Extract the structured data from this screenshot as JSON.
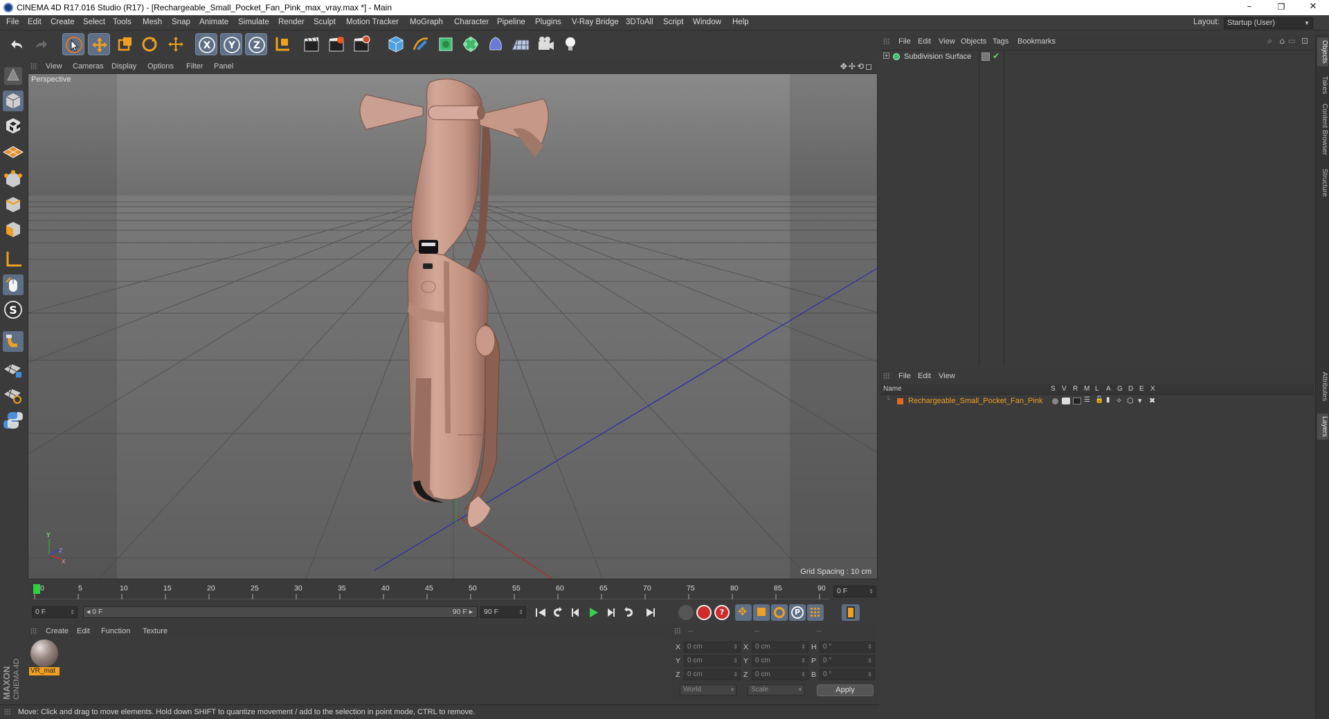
{
  "window": {
    "title": "CINEMA 4D R17.016 Studio (R17) - [Rechargeable_Small_Pocket_Fan_Pink_max_vray.max *] - Main",
    "minimize": "–",
    "restore": "❐",
    "close": "✕"
  },
  "menubar": {
    "items": [
      "File",
      "Edit",
      "Create",
      "Select",
      "Tools",
      "Mesh",
      "Snap",
      "Animate",
      "Simulate",
      "Render",
      "Sculpt",
      "Motion Tracker",
      "MoGraph",
      "Character",
      "Pipeline",
      "Plugins",
      "V-Ray Bridge",
      "3DToAll",
      "Script",
      "Window",
      "Help"
    ],
    "layout_label": "Layout:",
    "layout_value": "Startup (User)"
  },
  "viewport": {
    "menu": [
      "View",
      "Cameras",
      "Display",
      "Options",
      "Filter",
      "Panel"
    ],
    "label": "Perspective",
    "grid_spacing": "Grid Spacing : 10 cm",
    "nav_icons": "✥✢⟲◻"
  },
  "timeline": {
    "ticks": [
      "0",
      "5",
      "10",
      "15",
      "20",
      "25",
      "30",
      "35",
      "40",
      "45",
      "50",
      "55",
      "60",
      "65",
      "70",
      "75",
      "80",
      "85",
      "90"
    ],
    "current_frame": "0 F",
    "start_field": "0 F",
    "range_start": "◂ 0 F",
    "range_end": "90 F ▸",
    "end_field": "90 F"
  },
  "material_manager": {
    "menu": [
      "Create",
      "Edit",
      "Function",
      "Texture"
    ],
    "materials": [
      {
        "name": "VR_mat"
      }
    ]
  },
  "coordinates": {
    "headers": [
      "--",
      "--",
      "--"
    ],
    "rows": [
      {
        "l1": "X",
        "v1": "0 cm",
        "l2": "X",
        "v2": "0 cm",
        "l3": "H",
        "v3": "0 °"
      },
      {
        "l1": "Y",
        "v1": "0 cm",
        "l2": "Y",
        "v2": "0 cm",
        "l3": "P",
        "v3": "0 °"
      },
      {
        "l1": "Z",
        "v1": "0 cm",
        "l2": "Z",
        "v2": "0 cm",
        "l3": "B",
        "v3": "0 °"
      }
    ],
    "mode1": "World",
    "mode2": "Scale",
    "apply": "Apply"
  },
  "status": {
    "text": "Move: Click and drag to move elements. Hold down SHIFT to quantize movement / add to the selection in point mode, CTRL to remove."
  },
  "object_manager": {
    "menu": [
      "File",
      "Edit",
      "View",
      "Objects",
      "Tags",
      "Bookmarks"
    ],
    "objects": [
      {
        "name": "Subdivision Surface"
      }
    ]
  },
  "layer_manager": {
    "menu": [
      "File",
      "Edit",
      "View"
    ],
    "columns": [
      "Name",
      "S",
      "V",
      "R",
      "M",
      "L",
      "A",
      "G",
      "D",
      "E",
      "X"
    ],
    "layers": [
      {
        "name": "Rechargeable_Small_Pocket_Fan_Pink",
        "color": "#e06a1e"
      }
    ]
  },
  "side_tabs": [
    "Objects",
    "Takes",
    "Content Browser",
    "Structure",
    "Attributes",
    "Layers"
  ],
  "brand": {
    "line1": "MAXON",
    "line2": "CINEMA 4D"
  },
  "colors": {
    "accent": "#5e6f86",
    "model": "#c89c8c",
    "layer_text": "#f0a020"
  }
}
